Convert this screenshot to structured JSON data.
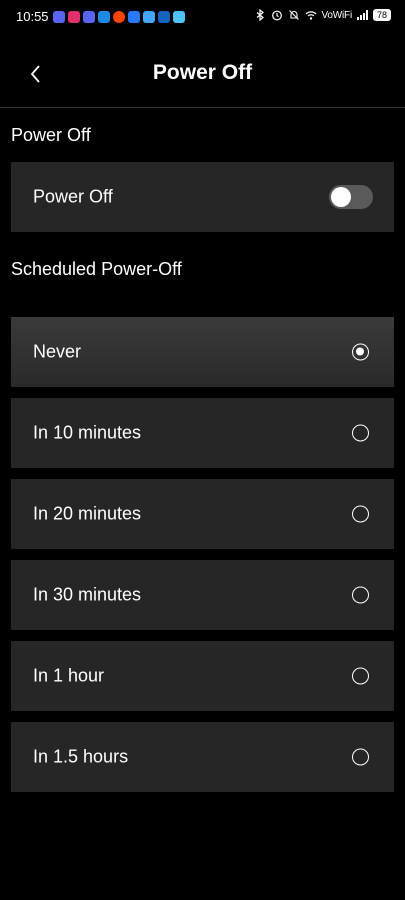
{
  "status_bar": {
    "time": "10:55",
    "network_label": "VoWiFi",
    "battery": "78",
    "notification_icons": [
      {
        "name": "discord-icon",
        "color": "#5865F2"
      },
      {
        "name": "heart-app-icon",
        "color": "#E1306C"
      },
      {
        "name": "discord-icon-2",
        "color": "#5865F2"
      },
      {
        "name": "youtube-icon",
        "color": "#1E88E5"
      },
      {
        "name": "reddit-icon",
        "color": "#FF4500"
      },
      {
        "name": "chat-app-icon",
        "color": "#2979FF"
      },
      {
        "name": "mail-icon",
        "color": "#42A5F5"
      },
      {
        "name": "paypal-icon",
        "color": "#1565C0"
      },
      {
        "name": "settings-app-icon",
        "color": "#4FC3F7"
      }
    ]
  },
  "header": {
    "title": "Power Off",
    "back_icon": "chevron-left-icon"
  },
  "power_off_section": {
    "title": "Power Off",
    "toggle_label": "Power Off",
    "toggle_on": false
  },
  "scheduled_section": {
    "title": "Scheduled Power-Off",
    "selected_index": 0,
    "options": [
      {
        "label": "Never"
      },
      {
        "label": "In 10 minutes"
      },
      {
        "label": "In 20 minutes"
      },
      {
        "label": "In 30 minutes"
      },
      {
        "label": "In 1 hour"
      },
      {
        "label": "In 1.5 hours"
      }
    ]
  },
  "colors": {
    "background": "#000000",
    "card": "#262626",
    "text": "#ffffff"
  }
}
